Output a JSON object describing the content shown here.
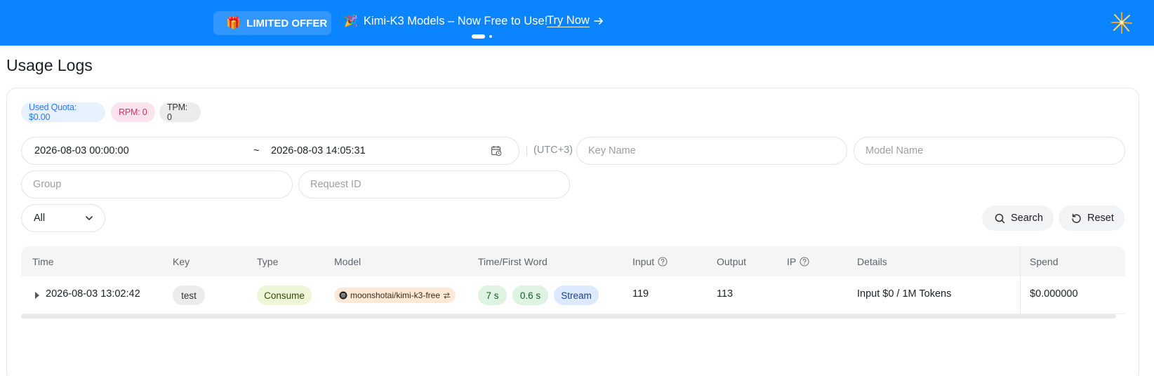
{
  "banner": {
    "offer_label": "LIMITED OFFER",
    "promo_text": "Kimi-K3 Models – Now Free to Use!",
    "cta_label": "Try Now",
    "bg_color": "#0a84ff"
  },
  "page": {
    "title": "Usage Logs"
  },
  "stats": {
    "quota": "Used Quota: $0.00",
    "rpm": "RPM: 0",
    "tpm": "TPM: 0"
  },
  "filters": {
    "date_start": "2026-08-03 00:00:00",
    "date_separator": "~",
    "date_end": "2026-08-03 14:05:31",
    "timezone": "(UTC+3)",
    "key_name_placeholder": "Key Name",
    "model_name_placeholder": "Model Name",
    "group_placeholder": "Group",
    "request_id_placeholder": "Request ID",
    "type_select_value": "All",
    "search_label": "Search",
    "reset_label": "Reset"
  },
  "table": {
    "columns": [
      "Time",
      "Key",
      "Type",
      "Model",
      "Time/First Word",
      "Input",
      "Output",
      "IP",
      "Details",
      "Spend"
    ],
    "rows": [
      {
        "time": "2026-08-03 13:02:42",
        "key": "test",
        "type": "Consume",
        "model": "moonshotai/kimi-k3-free",
        "duration": "7 s",
        "first_word": "0.6 s",
        "mode": "Stream",
        "input": "119",
        "output": "113",
        "ip": "",
        "details": "Input $0 / 1M Tokens",
        "spend": "$0.000000"
      }
    ]
  }
}
